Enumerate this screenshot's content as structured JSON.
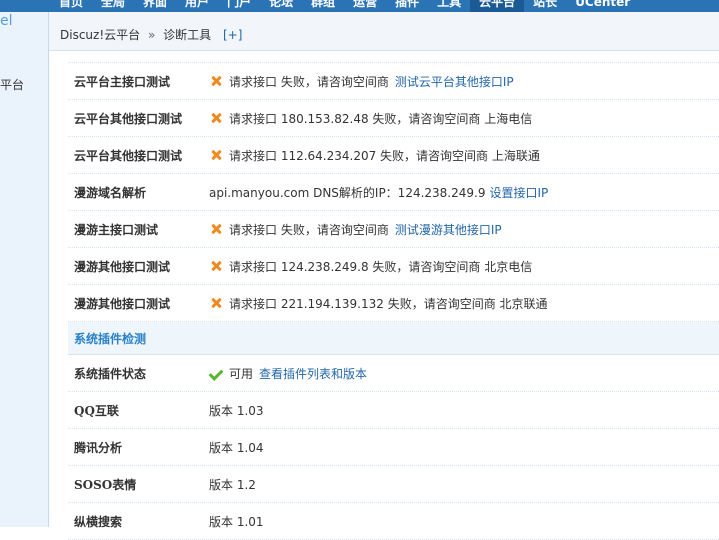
{
  "topnav": {
    "items": [
      "首页",
      "全局",
      "界面",
      "用户",
      "门户",
      "论坛",
      "群组",
      "运营",
      "插件",
      "工具",
      "云平台",
      "站长",
      "UCenter"
    ],
    "active_index": 10
  },
  "sidebar": {
    "brand_fragment": "el",
    "item_label": "平台"
  },
  "breadcrumb": {
    "root": "Discuz!云平台",
    "separator": "»",
    "current": "诊断工具",
    "add": "[+]"
  },
  "rows": [
    {
      "label": "云平台主接口测试",
      "icon": "error-x-icon",
      "text": "请求接口 失败，请咨询空间商",
      "link": "测试云平台其他接口IP"
    },
    {
      "label": "云平台其他接口测试",
      "icon": "error-x-icon",
      "text": "请求接口 180.153.82.48 失败，请咨询空间商 上海电信",
      "link": ""
    },
    {
      "label": "云平台其他接口测试",
      "icon": "error-x-icon",
      "text": "请求接口 112.64.234.207 失败，请咨询空间商 上海联通",
      "link": ""
    },
    {
      "label": "漫游域名解析",
      "icon": "",
      "text": "api.manyou.com DNS解析的IP：124.238.249.9",
      "link": "设置接口IP"
    },
    {
      "label": "漫游主接口测试",
      "icon": "error-x-icon",
      "text": "请求接口 失败，请咨询空间商",
      "link": "测试漫游其他接口IP"
    },
    {
      "label": "漫游其他接口测试",
      "icon": "error-x-icon",
      "text": "请求接口 124.238.249.8 失败，请咨询空间商 北京电信",
      "link": ""
    },
    {
      "label": "漫游其他接口测试",
      "icon": "error-x-icon",
      "text": "请求接口 221.194.139.132 失败，请咨询空间商 北京联通",
      "link": ""
    }
  ],
  "section": {
    "title": "系统插件检测"
  },
  "plugin_status": {
    "label": "系统插件状态",
    "icon": "check-icon",
    "text": "可用",
    "link": "查看插件列表和版本"
  },
  "plugins": [
    {
      "label": "QQ互联",
      "text": "版本 1.03"
    },
    {
      "label": "腾讯分析",
      "text": "版本 1.04"
    },
    {
      "label": "SOSO表情",
      "text": "版本 1.2"
    },
    {
      "label": "纵横搜索",
      "text": "版本 1.01"
    }
  ]
}
